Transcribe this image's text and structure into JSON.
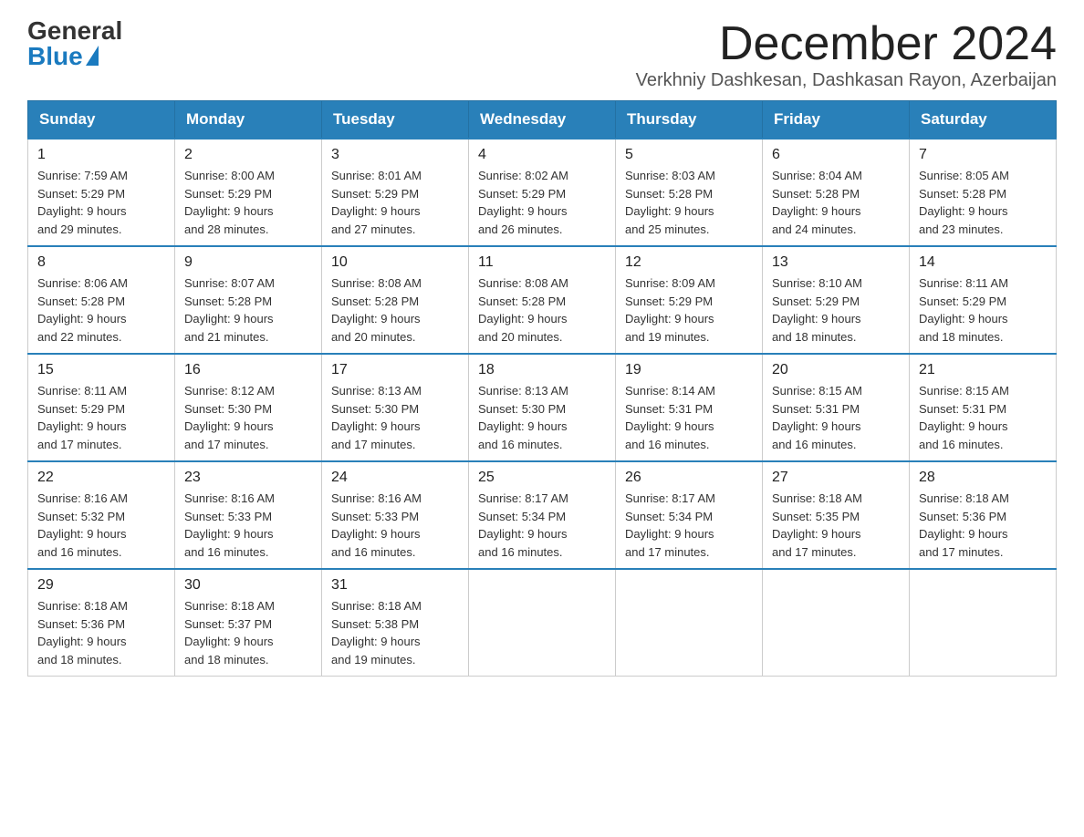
{
  "logo": {
    "general": "General",
    "blue": "Blue"
  },
  "header": {
    "month_year": "December 2024",
    "location": "Verkhniy Dashkesan, Dashkasan Rayon, Azerbaijan"
  },
  "days_of_week": [
    "Sunday",
    "Monday",
    "Tuesday",
    "Wednesday",
    "Thursday",
    "Friday",
    "Saturday"
  ],
  "weeks": [
    [
      {
        "day": "1",
        "sunrise": "7:59 AM",
        "sunset": "5:29 PM",
        "daylight": "9 hours and 29 minutes."
      },
      {
        "day": "2",
        "sunrise": "8:00 AM",
        "sunset": "5:29 PM",
        "daylight": "9 hours and 28 minutes."
      },
      {
        "day": "3",
        "sunrise": "8:01 AM",
        "sunset": "5:29 PM",
        "daylight": "9 hours and 27 minutes."
      },
      {
        "day": "4",
        "sunrise": "8:02 AM",
        "sunset": "5:29 PM",
        "daylight": "9 hours and 26 minutes."
      },
      {
        "day": "5",
        "sunrise": "8:03 AM",
        "sunset": "5:28 PM",
        "daylight": "9 hours and 25 minutes."
      },
      {
        "day": "6",
        "sunrise": "8:04 AM",
        "sunset": "5:28 PM",
        "daylight": "9 hours and 24 minutes."
      },
      {
        "day": "7",
        "sunrise": "8:05 AM",
        "sunset": "5:28 PM",
        "daylight": "9 hours and 23 minutes."
      }
    ],
    [
      {
        "day": "8",
        "sunrise": "8:06 AM",
        "sunset": "5:28 PM",
        "daylight": "9 hours and 22 minutes."
      },
      {
        "day": "9",
        "sunrise": "8:07 AM",
        "sunset": "5:28 PM",
        "daylight": "9 hours and 21 minutes."
      },
      {
        "day": "10",
        "sunrise": "8:08 AM",
        "sunset": "5:28 PM",
        "daylight": "9 hours and 20 minutes."
      },
      {
        "day": "11",
        "sunrise": "8:08 AM",
        "sunset": "5:28 PM",
        "daylight": "9 hours and 20 minutes."
      },
      {
        "day": "12",
        "sunrise": "8:09 AM",
        "sunset": "5:29 PM",
        "daylight": "9 hours and 19 minutes."
      },
      {
        "day": "13",
        "sunrise": "8:10 AM",
        "sunset": "5:29 PM",
        "daylight": "9 hours and 18 minutes."
      },
      {
        "day": "14",
        "sunrise": "8:11 AM",
        "sunset": "5:29 PM",
        "daylight": "9 hours and 18 minutes."
      }
    ],
    [
      {
        "day": "15",
        "sunrise": "8:11 AM",
        "sunset": "5:29 PM",
        "daylight": "9 hours and 17 minutes."
      },
      {
        "day": "16",
        "sunrise": "8:12 AM",
        "sunset": "5:30 PM",
        "daylight": "9 hours and 17 minutes."
      },
      {
        "day": "17",
        "sunrise": "8:13 AM",
        "sunset": "5:30 PM",
        "daylight": "9 hours and 17 minutes."
      },
      {
        "day": "18",
        "sunrise": "8:13 AM",
        "sunset": "5:30 PM",
        "daylight": "9 hours and 16 minutes."
      },
      {
        "day": "19",
        "sunrise": "8:14 AM",
        "sunset": "5:31 PM",
        "daylight": "9 hours and 16 minutes."
      },
      {
        "day": "20",
        "sunrise": "8:15 AM",
        "sunset": "5:31 PM",
        "daylight": "9 hours and 16 minutes."
      },
      {
        "day": "21",
        "sunrise": "8:15 AM",
        "sunset": "5:31 PM",
        "daylight": "9 hours and 16 minutes."
      }
    ],
    [
      {
        "day": "22",
        "sunrise": "8:16 AM",
        "sunset": "5:32 PM",
        "daylight": "9 hours and 16 minutes."
      },
      {
        "day": "23",
        "sunrise": "8:16 AM",
        "sunset": "5:33 PM",
        "daylight": "9 hours and 16 minutes."
      },
      {
        "day": "24",
        "sunrise": "8:16 AM",
        "sunset": "5:33 PM",
        "daylight": "9 hours and 16 minutes."
      },
      {
        "day": "25",
        "sunrise": "8:17 AM",
        "sunset": "5:34 PM",
        "daylight": "9 hours and 16 minutes."
      },
      {
        "day": "26",
        "sunrise": "8:17 AM",
        "sunset": "5:34 PM",
        "daylight": "9 hours and 17 minutes."
      },
      {
        "day": "27",
        "sunrise": "8:18 AM",
        "sunset": "5:35 PM",
        "daylight": "9 hours and 17 minutes."
      },
      {
        "day": "28",
        "sunrise": "8:18 AM",
        "sunset": "5:36 PM",
        "daylight": "9 hours and 17 minutes."
      }
    ],
    [
      {
        "day": "29",
        "sunrise": "8:18 AM",
        "sunset": "5:36 PM",
        "daylight": "9 hours and 18 minutes."
      },
      {
        "day": "30",
        "sunrise": "8:18 AM",
        "sunset": "5:37 PM",
        "daylight": "9 hours and 18 minutes."
      },
      {
        "day": "31",
        "sunrise": "8:18 AM",
        "sunset": "5:38 PM",
        "daylight": "9 hours and 19 minutes."
      },
      null,
      null,
      null,
      null
    ]
  ]
}
